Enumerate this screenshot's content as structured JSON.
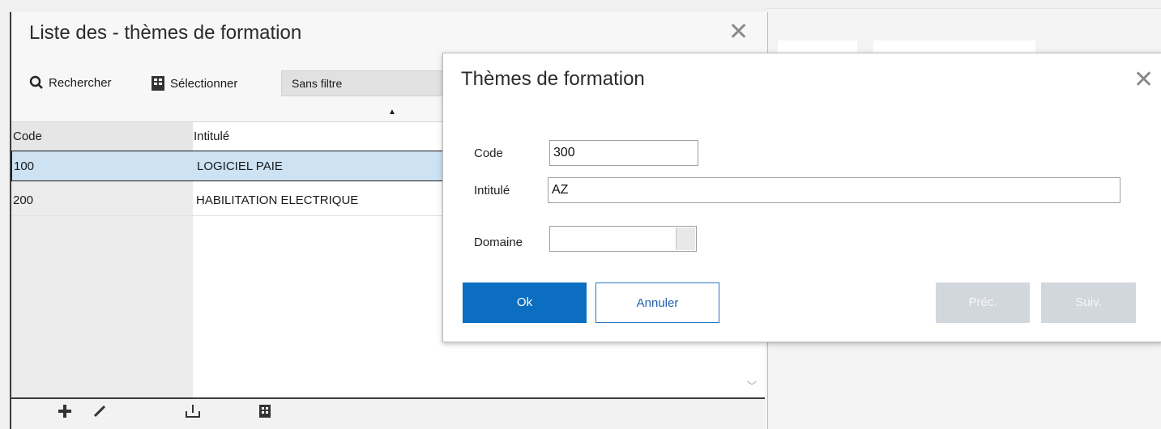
{
  "list_window": {
    "title": "Liste des - thèmes de formation",
    "close_glyph": "✕",
    "toolbar": {
      "search_label": "Rechercher",
      "select_label": "Sélectionner",
      "filter_value": "Sans filtre"
    },
    "columns": [
      "Code",
      "Intitulé"
    ],
    "rows": [
      {
        "code": "100",
        "label": "LOGICIEL PAIE"
      },
      {
        "code": "200",
        "label": "HABILITATION ELECTRIQUE"
      }
    ],
    "footer_icons": [
      "plus-icon",
      "pencil-icon",
      "export-icon",
      "print-icon"
    ]
  },
  "dialog": {
    "title": "Thèmes de formation",
    "close_glyph": "✕",
    "code_label": "Code",
    "code_value": "300",
    "intitule_label": "Intitulé",
    "intitule_value": "AZ",
    "domaine_label": "Domaine",
    "domaine_value": "",
    "ok_label": "Ok",
    "cancel_label": "Annuler",
    "prev_label": "Préc.",
    "next_label": "Suiv."
  },
  "colors": {
    "primary_button": "#0b6ec0",
    "selected_row": "#cde2f3",
    "disabled_button": "#d2d7de"
  }
}
